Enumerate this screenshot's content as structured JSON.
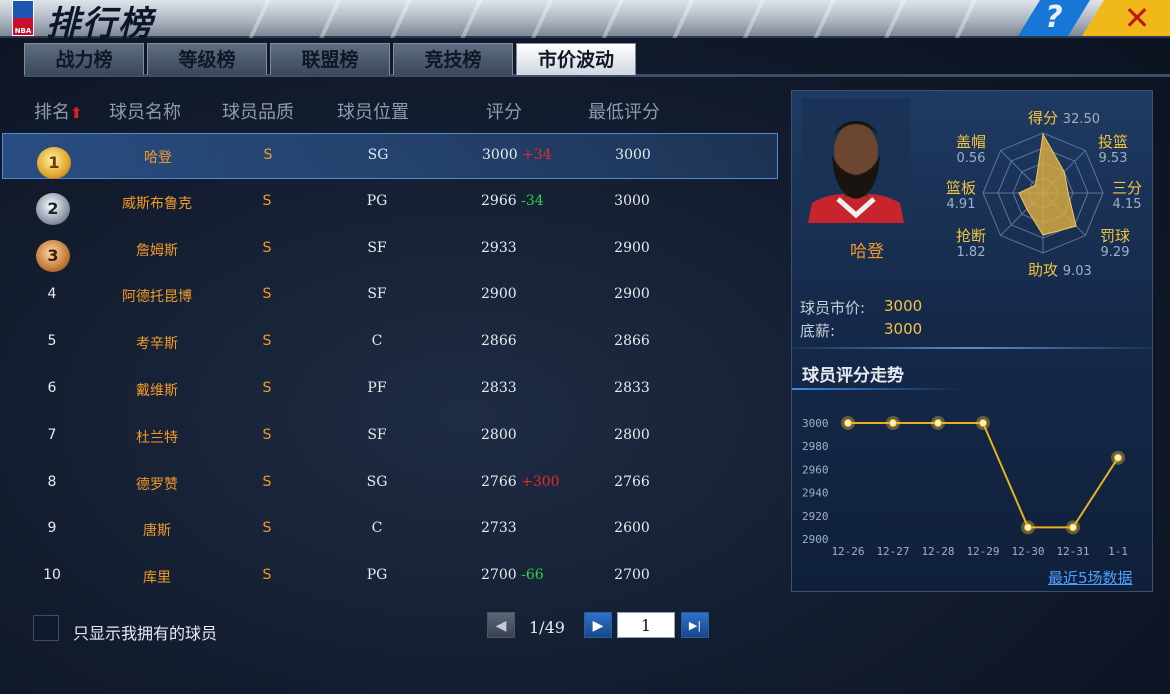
{
  "window": {
    "title": "排行榜",
    "logo_text": "NBA",
    "help_icon": "?",
    "close_icon": "✕"
  },
  "tabs": [
    {
      "label": "战力榜",
      "active": false
    },
    {
      "label": "等级榜",
      "active": false
    },
    {
      "label": "联盟榜",
      "active": false
    },
    {
      "label": "竞技榜",
      "active": false
    },
    {
      "label": "市价波动",
      "active": true
    }
  ],
  "table": {
    "headers": {
      "rank": "排名",
      "rank_sort_arrow": "⬆",
      "name": "球员名称",
      "quality": "球员品质",
      "position": "球员位置",
      "score": "评分",
      "min_score": "最低评分"
    },
    "rows": [
      {
        "rank": "1",
        "name": "哈登",
        "quality": "S",
        "position": "SG",
        "score": "3000",
        "change": "+34",
        "change_dir": "up",
        "min_score": "3000"
      },
      {
        "rank": "2",
        "name": "威斯布鲁克",
        "quality": "S",
        "position": "PG",
        "score": "2966",
        "change": "-34",
        "change_dir": "down",
        "min_score": "3000"
      },
      {
        "rank": "3",
        "name": "詹姆斯",
        "quality": "S",
        "position": "SF",
        "score": "2933",
        "change": "",
        "change_dir": "",
        "min_score": "2900"
      },
      {
        "rank": "4",
        "name": "阿德托昆博",
        "quality": "S",
        "position": "SF",
        "score": "2900",
        "change": "",
        "change_dir": "",
        "min_score": "2900"
      },
      {
        "rank": "5",
        "name": "考辛斯",
        "quality": "S",
        "position": "C",
        "score": "2866",
        "change": "",
        "change_dir": "",
        "min_score": "2866"
      },
      {
        "rank": "6",
        "name": "戴维斯",
        "quality": "S",
        "position": "PF",
        "score": "2833",
        "change": "",
        "change_dir": "",
        "min_score": "2833"
      },
      {
        "rank": "7",
        "name": "杜兰特",
        "quality": "S",
        "position": "SF",
        "score": "2800",
        "change": "",
        "change_dir": "",
        "min_score": "2800"
      },
      {
        "rank": "8",
        "name": "德罗赞",
        "quality": "S",
        "position": "SG",
        "score": "2766",
        "change": "+300",
        "change_dir": "up",
        "min_score": "2766"
      },
      {
        "rank": "9",
        "name": "唐斯",
        "quality": "S",
        "position": "C",
        "score": "2733",
        "change": "",
        "change_dir": "",
        "min_score": "2600"
      },
      {
        "rank": "10",
        "name": "库里",
        "quality": "S",
        "position": "PG",
        "score": "2700",
        "change": "-66",
        "change_dir": "down",
        "min_score": "2700"
      }
    ]
  },
  "footer": {
    "only_owned_label": "只显示我拥有的球员",
    "page_info": "1/49",
    "page_input": "1",
    "prev_icon": "◀",
    "next_icon": "▶",
    "last_icon": "▶|"
  },
  "detail": {
    "player_name": "哈登",
    "radar": [
      {
        "label": "得分",
        "value": "32.50"
      },
      {
        "label": "投篮",
        "value": "9.53"
      },
      {
        "label": "三分",
        "value": "4.15"
      },
      {
        "label": "罚球",
        "value": "9.29"
      },
      {
        "label": "助攻",
        "value": "9.03"
      },
      {
        "label": "抢断",
        "value": "1.82"
      },
      {
        "label": "篮板",
        "value": "4.91"
      },
      {
        "label": "盖帽",
        "value": "0.56"
      }
    ],
    "radar_fill": [
      0.98,
      0.5,
      0.42,
      0.78,
      0.7,
      0.38,
      0.4,
      0.18
    ],
    "market_price_label": "球员市价:",
    "market_price": "3000",
    "base_salary_label": "底薪:",
    "base_salary": "3000",
    "trend_title": "球员评分走势",
    "recent_link": "最近5场数据",
    "colors": {
      "line": "#e8b020",
      "fill": "#e0b040"
    }
  },
  "chart_data": {
    "type": "line",
    "categories": [
      "12-26",
      "12-27",
      "12-28",
      "12-29",
      "12-30",
      "12-31",
      "1-1"
    ],
    "values": [
      3000,
      3000,
      3000,
      3000,
      2910,
      2910,
      2970
    ],
    "yticks": [
      3000,
      2980,
      2960,
      2940,
      2920,
      2900
    ],
    "ylim": [
      2900,
      3000
    ],
    "title": "",
    "xlabel": "",
    "ylabel": ""
  }
}
